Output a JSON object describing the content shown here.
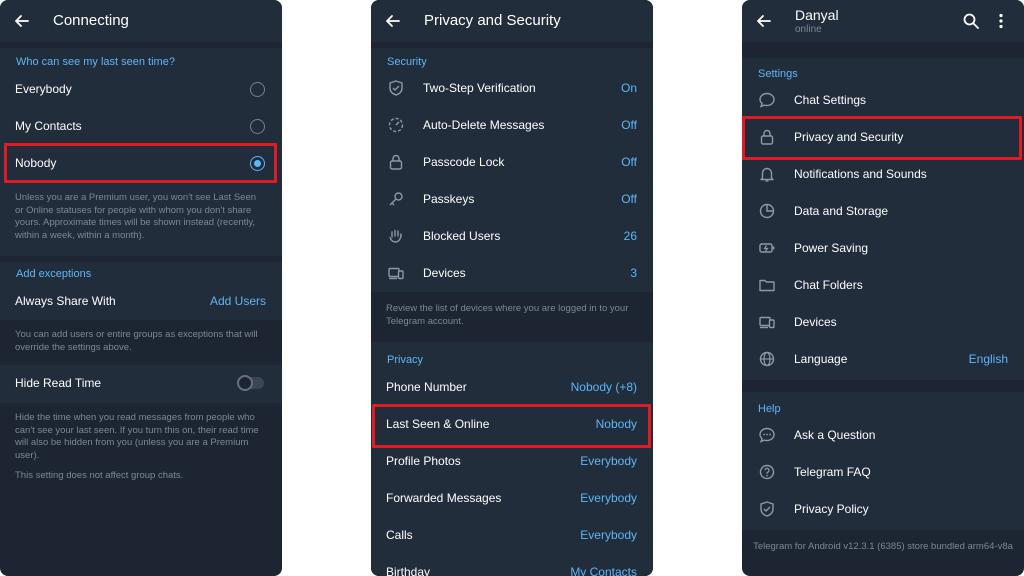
{
  "panel1": {
    "title": "Connecting",
    "header_last_seen": "Who can see my last seen time?",
    "options": [
      {
        "label": "Everybody",
        "selected": false
      },
      {
        "label": "My Contacts",
        "selected": false
      },
      {
        "label": "Nobody",
        "selected": true
      }
    ],
    "premium_note": "Unless you are a Premium user, you won't see Last Seen or Online statuses for people with whom you don't share yours. Approximate times will be shown instead (recently, within a week, within a month).",
    "header_exceptions": "Add exceptions",
    "always_share_label": "Always Share With",
    "always_share_value": "Add Users",
    "exceptions_note": "You can add users or entire groups as exceptions that will override the settings above.",
    "hide_read_time_label": "Hide Read Time",
    "hide_read_time_on": false,
    "read_time_note": "Hide the time when you read messages from people who can't see your last seen. If you turn this on, their read time will also be hidden from you (unless you are a Premium user).",
    "group_note": "This setting does not affect group chats."
  },
  "panel2": {
    "title": "Privacy and Security",
    "header_security": "Security",
    "security_items": [
      {
        "label": "Two-Step Verification",
        "value": "On",
        "icon": "shield-check-icon"
      },
      {
        "label": "Auto-Delete Messages",
        "value": "Off",
        "icon": "timer-icon"
      },
      {
        "label": "Passcode Lock",
        "value": "Off",
        "icon": "lock-icon"
      },
      {
        "label": "Passkeys",
        "value": "Off",
        "icon": "key-icon"
      },
      {
        "label": "Blocked Users",
        "value": "26",
        "icon": "hand-icon"
      },
      {
        "label": "Devices",
        "value": "3",
        "icon": "devices-icon"
      }
    ],
    "devices_note": "Review the list of devices where you are logged in to your Telegram account.",
    "header_privacy": "Privacy",
    "privacy_items": [
      {
        "label": "Phone Number",
        "value": "Nobody (+8)"
      },
      {
        "label": "Last Seen & Online",
        "value": "Nobody"
      },
      {
        "label": "Profile Photos",
        "value": "Everybody"
      },
      {
        "label": "Forwarded Messages",
        "value": "Everybody"
      },
      {
        "label": "Calls",
        "value": "Everybody"
      },
      {
        "label": "Birthday",
        "value": "My Contacts"
      }
    ]
  },
  "panel3": {
    "name": "Danyal",
    "status": "online",
    "header_settings": "Settings",
    "settings_items": [
      {
        "label": "Chat Settings",
        "value": "",
        "icon": "chat-bubble-icon"
      },
      {
        "label": "Privacy and Security",
        "value": "",
        "icon": "lock-icon"
      },
      {
        "label": "Notifications and Sounds",
        "value": "",
        "icon": "bell-icon"
      },
      {
        "label": "Data and Storage",
        "value": "",
        "icon": "pie-chart-icon"
      },
      {
        "label": "Power Saving",
        "value": "",
        "icon": "battery-icon"
      },
      {
        "label": "Chat Folders",
        "value": "",
        "icon": "folder-icon"
      },
      {
        "label": "Devices",
        "value": "",
        "icon": "devices-icon"
      },
      {
        "label": "Language",
        "value": "English",
        "icon": "globe-icon"
      }
    ],
    "header_help": "Help",
    "help_items": [
      {
        "label": "Ask a Question",
        "icon": "chat-dots-icon"
      },
      {
        "label": "Telegram FAQ",
        "icon": "question-circle-icon"
      },
      {
        "label": "Privacy Policy",
        "icon": "shield-check-icon"
      }
    ],
    "version_note": "Telegram for Android v12.3.1 (6385) store bundled arm64-v8a"
  },
  "colors": {
    "background": "#1c2531",
    "section": "#212d3b",
    "accent": "#5eb5f7",
    "muted_text": "#7c8896",
    "highlight": "#e01b24"
  }
}
